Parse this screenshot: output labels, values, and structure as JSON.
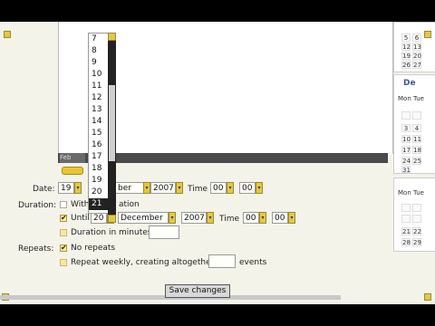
{
  "dark_band_label": "Feb",
  "dropdown_options": [
    "7",
    "8",
    "9",
    "10",
    "11",
    "12",
    "13",
    "14",
    "15",
    "16",
    "17",
    "18",
    "19",
    "20",
    "21"
  ],
  "form": {
    "date_label": "Date:",
    "date_day": "19",
    "date_month": "ber",
    "date_year": "2007",
    "time_label": "Time",
    "date_hour": "00",
    "date_min": "00",
    "duration_label": "Duration:",
    "without_duration": "With",
    "without_duration_tail": "ation",
    "until_label": "Until",
    "until_day": "20",
    "until_month": "December",
    "until_year": "2007",
    "until_time_label": "Time",
    "until_hour": "00",
    "until_min": "00",
    "duration_minutes_label": "Duration in minutes",
    "duration_minutes_value": "",
    "repeats_label": "Repeats:",
    "no_repeats_label": "No repeats",
    "repeat_weekly_label": "Repeat weekly, creating altogether",
    "repeat_count_value": "",
    "events_label": "events",
    "save_label": "Save changes"
  },
  "mini_cal_top": [
    "5",
    "6",
    "12",
    "13",
    "19",
    "20",
    "26",
    "27"
  ],
  "mini_cal_month": "De",
  "mini_cal_days": "Mon Tue",
  "mini_cal_mid": [
    "3",
    "4",
    "10",
    "11",
    "17",
    "18",
    "24",
    "25",
    "31"
  ],
  "mini_cal_days2": "Mon Tue",
  "mini_cal_bot": [
    "21",
    "22",
    "28",
    "29"
  ]
}
